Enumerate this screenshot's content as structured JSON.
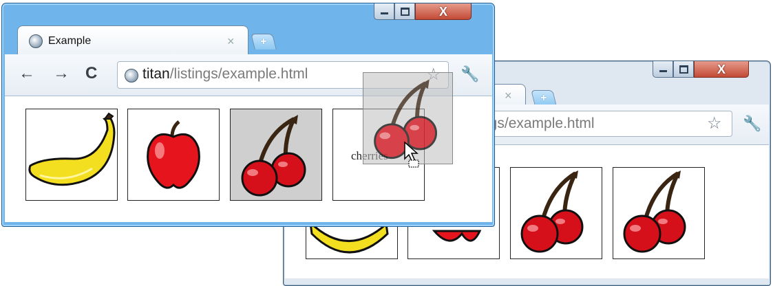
{
  "browser_front": {
    "tab": {
      "title": "Example",
      "close": "×"
    },
    "new_tab": "+",
    "toolbar": {
      "back": "←",
      "forward": "→",
      "reload": "C",
      "star": "☆",
      "wrench": "🔧"
    },
    "address": {
      "host": "titan",
      "path": "/listings/example.html"
    },
    "tiles": [
      {
        "icon": "banana-icon",
        "label": ""
      },
      {
        "icon": "apple-icon",
        "label": ""
      },
      {
        "icon": "cherries-icon",
        "label": ""
      },
      {
        "icon": "",
        "label": "cherries"
      }
    ],
    "drag_ghost_icon": "cherries-icon",
    "caption": {
      "minimize": "",
      "maximize": "",
      "close": "X"
    }
  },
  "browser_back": {
    "tab": {
      "close": "×"
    },
    "new_tab": "+",
    "address": {
      "path_visible": "ngs/example.html"
    },
    "toolbar": {
      "star": "☆",
      "wrench": "🔧"
    },
    "tiles": [
      {
        "icon": "banana-icon"
      },
      {
        "icon": "apple-icon"
      },
      {
        "icon": "cherries-icon"
      },
      {
        "icon": "cherries-icon"
      }
    ],
    "caption": {
      "close": "X"
    }
  },
  "colors": {
    "window_frame": "#6fb5ec",
    "cherry": "#d6101a",
    "banana": "#f3df1f",
    "apple": "#e5141d",
    "stem": "#3a2513"
  }
}
